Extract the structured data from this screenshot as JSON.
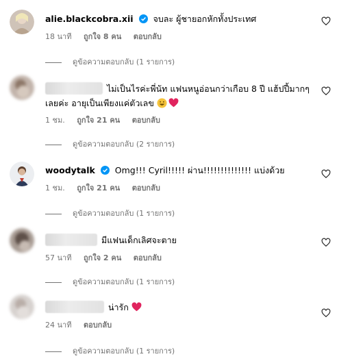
{
  "comments": [
    {
      "username": "alie.blackcobra.xii",
      "verified": true,
      "text": "จบละ ผู้ชายอกหักทั้งประเทศ",
      "time": "18 นาที",
      "likes": "ถูกใจ 8 คน",
      "reply": "ตอบกลับ",
      "view_replies": "ดูข้อความตอบกลับ (1 รายการ)"
    },
    {
      "username": "",
      "verified": false,
      "text": "ไม่เป็นไรค่ะพี่นัท แฟนหนูอ่อนกว่าเกือบ 8 ปี แฮ้ปปี้มากๆเลยค่ะ อายุเป็นเพียงแค่ตัวเลข",
      "time": "1 ชม.",
      "likes": "ถูกใจ 21 คน",
      "reply": "ตอบกลับ",
      "view_replies": "ดูข้อความตอบกลับ (2 รายการ)"
    },
    {
      "username": "woodytalk",
      "verified": true,
      "text": "Omg!!! Cyril!!!!! ผ่าน!!!!!!!!!!!!!! แบ่งด้วย",
      "time": "1 ชม.",
      "likes": "ถูกใจ 21 คน",
      "reply": "ตอบกลับ",
      "view_replies": "ดูข้อความตอบกลับ (1 รายการ)"
    },
    {
      "username": "",
      "verified": false,
      "text": "มีแฟนเด็กเลิศจะตาย",
      "time": "57 นาที",
      "likes": "ถูกใจ 2 คน",
      "reply": "ตอบกลับ",
      "view_replies": "ดูข้อความตอบกลับ (1 รายการ)"
    },
    {
      "username": "",
      "verified": false,
      "text": "น่ารัก",
      "time": "24 นาที",
      "likes": "",
      "reply": "ตอบกลับ",
      "view_replies": "ดูข้อความตอบกลับ (1 รายการ)"
    }
  ],
  "icons": {
    "verified": "verified-badge-icon",
    "like": "heart-outline-icon",
    "heart_emoji": "red-heart-emoji",
    "grin_emoji": "grinning-face-emoji"
  },
  "colors": {
    "verified": "#0095f6",
    "meta": "#737373",
    "heart_emoji": "#e0245e"
  }
}
